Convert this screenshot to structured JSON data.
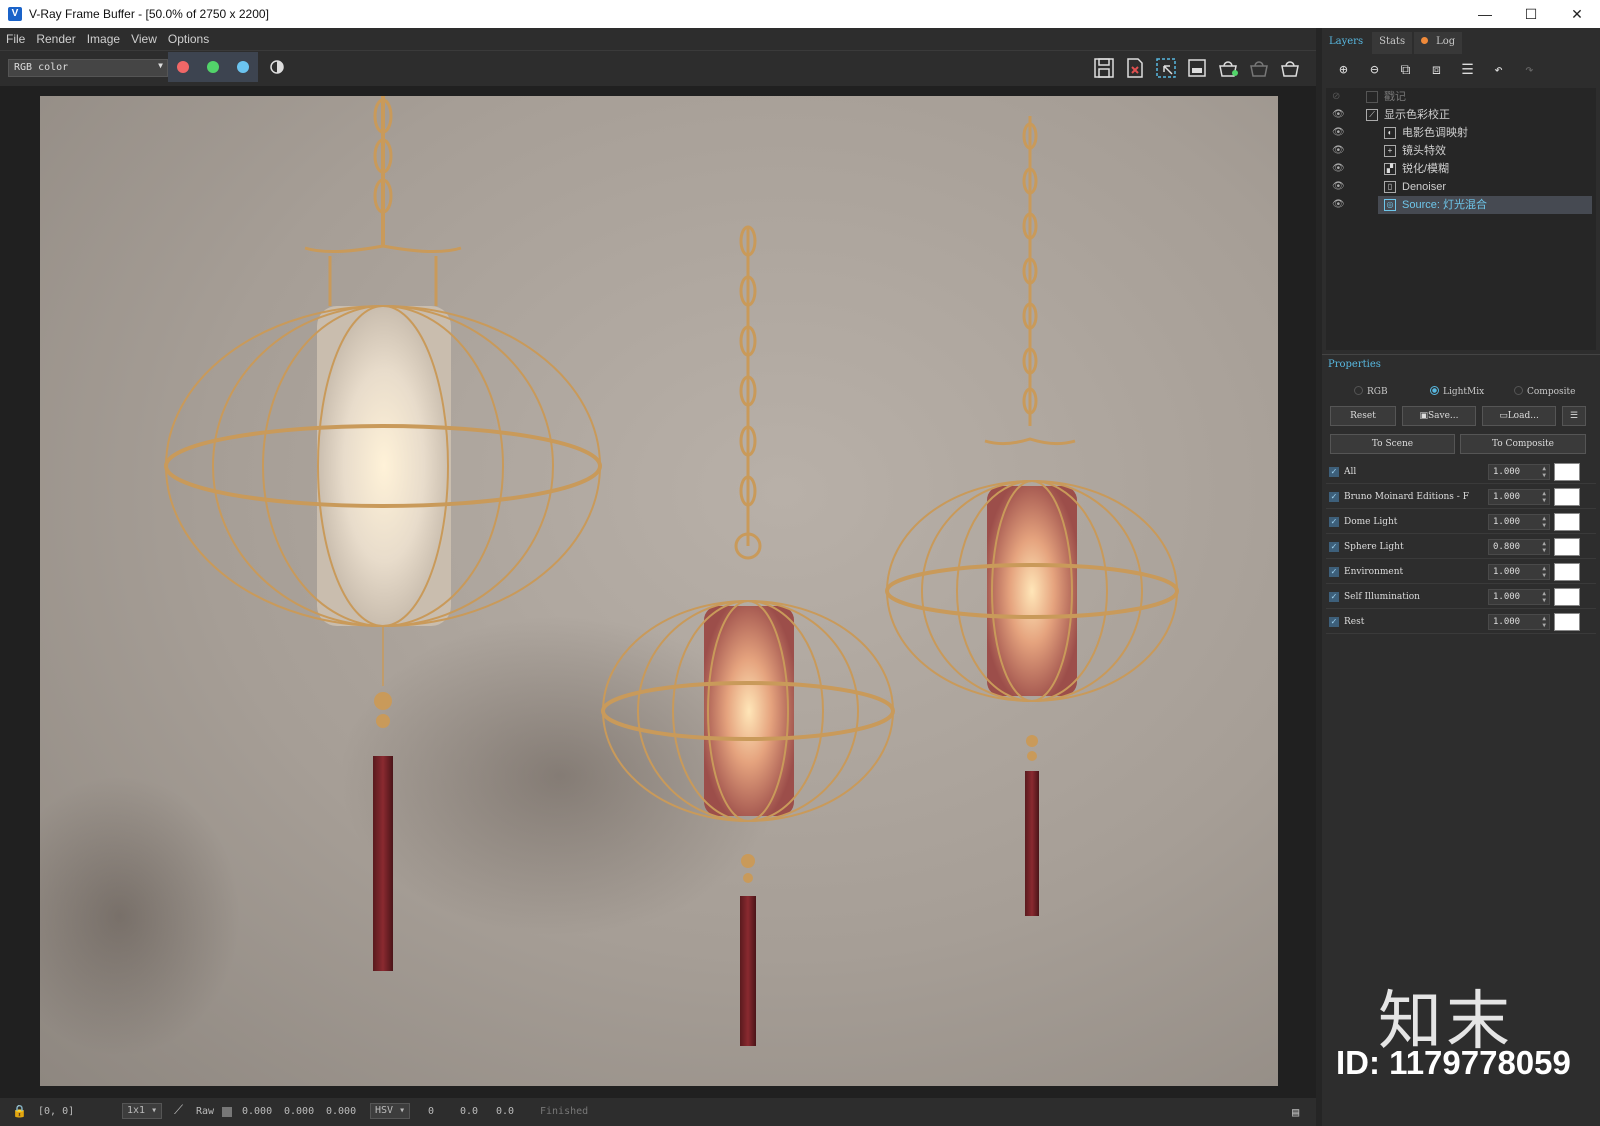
{
  "window": {
    "title": "V-Ray Frame Buffer - [50.0% of 2750 x 2200]",
    "minimize": "—",
    "maximize": "☐",
    "close": "✕"
  },
  "menu": [
    "File",
    "Render",
    "Image",
    "View",
    "Options"
  ],
  "toolbar": {
    "channel": "RGB color",
    "channel_colors": {
      "red": "#f06767",
      "green": "#52d46a",
      "blue": "#6bc4f0"
    }
  },
  "status": {
    "coords": "[0, 0]",
    "zoom": "1x1",
    "mode": "Raw",
    "rgb_values": [
      "0.000",
      "0.000",
      "0.000"
    ],
    "color_space": "HSV",
    "hsv_values": [
      "0",
      "0.0",
      "0.0"
    ],
    "state": "Finished"
  },
  "panel": {
    "tabs": [
      "Layers",
      "Stats",
      "Log"
    ],
    "layers": [
      {
        "name": "戳记",
        "icon": "",
        "indent": 0
      },
      {
        "name": "显示色彩校正",
        "icon": "⟋",
        "indent": 0
      },
      {
        "name": "电影色调映射",
        "icon": "◐",
        "indent": 1
      },
      {
        "name": "镜头特效",
        "icon": "+",
        "indent": 1
      },
      {
        "name": "锐化/模糊",
        "icon": "▞",
        "indent": 1
      },
      {
        "name": "Denoiser",
        "icon": "▯",
        "indent": 1
      },
      {
        "name": "Source: 灯光混合",
        "icon": "◎",
        "indent": 1
      }
    ],
    "properties_title": "Properties",
    "modes": [
      "RGB",
      "LightMix",
      "Composite"
    ],
    "selected_mode": "LightMix",
    "buttons": {
      "reset": "Reset",
      "save": "Save...",
      "load": "Load...",
      "to_scene": "To Scene",
      "to_composite": "To Composite"
    },
    "lightmix": [
      {
        "name": "All",
        "value": "1.000"
      },
      {
        "name": "Bruno Moinard Editions - F",
        "value": "1.000"
      },
      {
        "name": "Dome Light",
        "value": "1.000"
      },
      {
        "name": "Sphere Light",
        "value": "0.800"
      },
      {
        "name": "Environment",
        "value": "1.000"
      },
      {
        "name": "Self Illumination",
        "value": "1.000"
      },
      {
        "name": "Rest",
        "value": "1.000"
      }
    ]
  },
  "watermark": {
    "brand": "知末",
    "id": "ID: 1179778059"
  }
}
